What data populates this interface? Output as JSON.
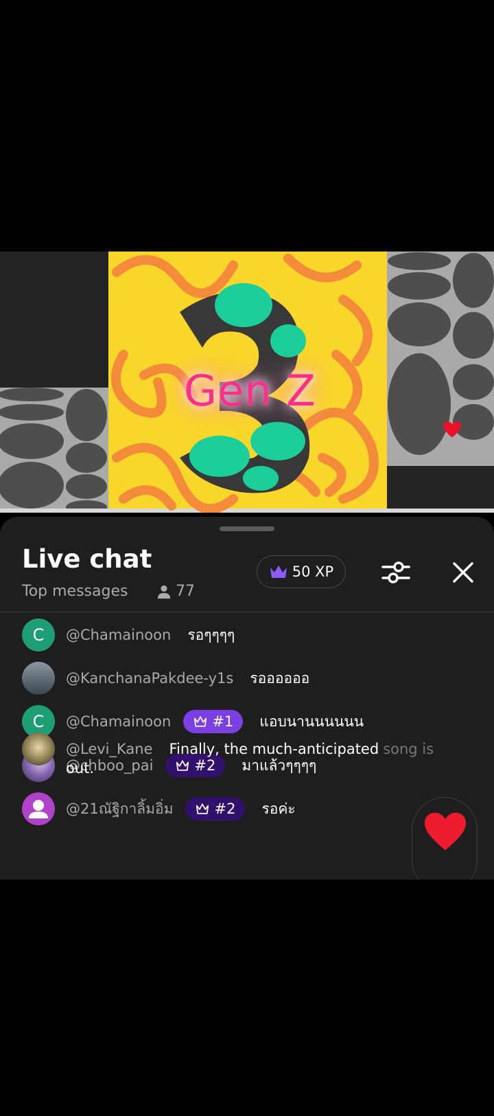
{
  "video": {
    "overlay_text": "Gen Z"
  },
  "chat": {
    "title": "Live chat",
    "subtitle": "Top messages",
    "viewer_count": "77",
    "xp": "50 XP",
    "icons": {
      "viewers": "person-icon",
      "xp": "crown-icon",
      "filter": "sliders-icon",
      "close": "close-icon",
      "react": "heart-icon"
    },
    "accent_colors": {
      "badge_rank1": "#7b3fe4",
      "badge_rank2": "#32106e",
      "xp_crown": "#8b5cf6"
    },
    "messages": [
      {
        "avatar_letter": "C",
        "avatar_color": "#1d9e74",
        "author": "@Chamainoon",
        "text": "รอๆๆๆๆ"
      },
      {
        "avatar_letter": "",
        "avatar_color": "#6f7c86",
        "author": "@KanchanaPakdee-y1s",
        "text": "รออออออ"
      },
      {
        "avatar_letter": "C",
        "avatar_color": "#1d9e74",
        "author": "@Chamainoon",
        "badge": "#1",
        "text": "แอบนานนนนนน"
      },
      {
        "avatar_letter": "",
        "avatar_color": "#8a6ab8",
        "author": "@chboo_pai",
        "badge": "#2",
        "text": "มาแล้วๆๆๆๆ"
      },
      {
        "avatar_letter": "",
        "avatar_color": "#b042c9",
        "author": "@21ณัฐิกาลิ้มอิ่ม",
        "badge": "#2",
        "text": "รอค่ะ"
      },
      {
        "avatar_letter": "",
        "avatar_color": "#8a7a50",
        "author": "@Levi_Kane",
        "text": "Finally, the much-anticipated",
        "text_hidden": "song is",
        "text_cont": "out."
      }
    ]
  }
}
